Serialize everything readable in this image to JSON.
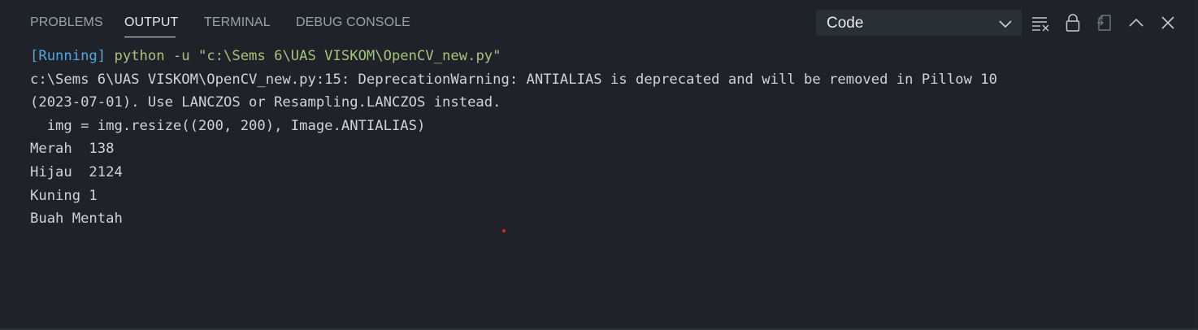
{
  "tabs": [
    {
      "label": "PROBLEMS"
    },
    {
      "label": "OUTPUT"
    },
    {
      "label": "TERMINAL"
    },
    {
      "label": "DEBUG CONSOLE"
    }
  ],
  "active_tab": "OUTPUT",
  "channel_select": {
    "value": "Code"
  },
  "actions": {
    "clear_icon": "clear-output-icon",
    "lock_icon": "lock-scroll-icon",
    "open_editor_icon": "open-in-editor-icon",
    "maximize_icon": "chevron-up-icon",
    "close_icon": "close-icon"
  },
  "output": {
    "running_tag": "[Running]",
    "running_cmd": " python -u \"c:\\Sems 6\\UAS VISKOM\\OpenCV_new.py\"",
    "lines": [
      "c:\\Sems 6\\UAS VISKOM\\OpenCV_new.py:15: DeprecationWarning: ANTIALIAS is deprecated and will be removed in Pillow 10",
      "(2023-07-01). Use LANCZOS or Resampling.LANCZOS instead.",
      "  img = img.resize((200, 200), Image.ANTIALIAS)",
      "Merah  138",
      "Hijau  2124",
      "Kuning 1",
      "Buah Mentah"
    ]
  },
  "colors": {
    "background": "#1f2329",
    "running_tag": "#4fa6e0",
    "running_cmd": "#a6c37a",
    "text": "#cfd3d8"
  }
}
